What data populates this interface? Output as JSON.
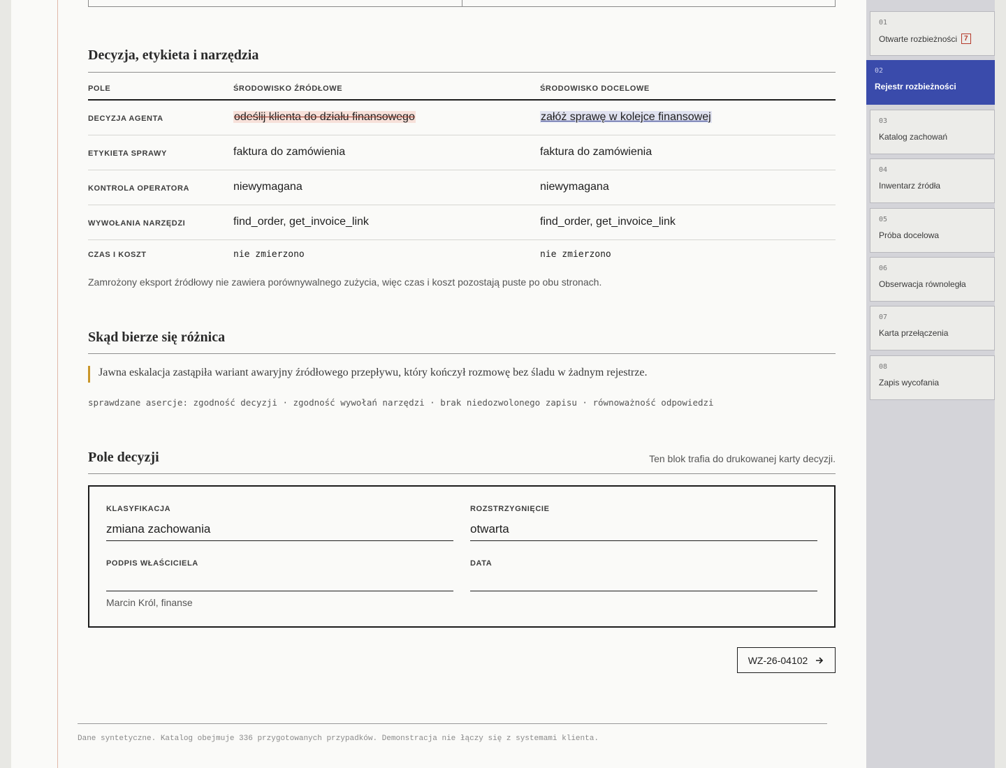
{
  "table_section": {
    "title": "Decyzja, etykieta i narzędzia",
    "columns": [
      "POLE",
      "ŚRODOWISKO ŹRÓDŁOWE",
      "ŚRODOWISKO DOCELOWE"
    ],
    "rows": [
      {
        "label": "DECYZJA AGENTA",
        "source": "odeślij klienta do działu finansowego",
        "target": "załóż sprawę w kolejce finansowej"
      },
      {
        "label": "ETYKIETA SPRAWY",
        "source": "faktura do zamówienia",
        "target": "faktura do zamówienia"
      },
      {
        "label": "KONTROLA OPERATORA",
        "source": "niewymagana",
        "target": "niewymagana"
      },
      {
        "label": "WYWOŁANIA NARZĘDZI",
        "source": "find_order, get_invoice_link",
        "target": "find_order, get_invoice_link"
      },
      {
        "label": "CZAS I KOSZT",
        "source": "nie zmierzono",
        "target": "nie zmierzono"
      }
    ],
    "note": "Zamrożony eksport źródłowy nie zawiera porównywalnego zużycia, więc czas i koszt pozostają puste po obu stronach."
  },
  "difference_section": {
    "title": "Skąd bierze się różnica",
    "quote": "Jawna eskalacja zastąpiła wariant awaryjny źródłowego przepływu, który kończył rozmowę bez śladu w żadnym rejestrze.",
    "assertions": "sprawdzane asercje: zgodność decyzji · zgodność wywołań narzędzi · brak niedozwolonego zapisu · równoważność odpowiedzi"
  },
  "decision_section": {
    "title": "Pole decyzji",
    "print_note": "Ten blok trafia do drukowanej karty decyzji.",
    "classification_label": "KLASYFIKACJA",
    "classification_value": "zmiana zachowania",
    "resolution_label": "ROZSTRZYGNIĘCIE",
    "resolution_value": "otwarta",
    "signature_label": "PODPIS WŁAŚCICIELA",
    "signature_value": "",
    "date_label": "DATA",
    "date_value": "",
    "owner": "Marcin Król, finanse"
  },
  "next_button": {
    "label": "WZ-26-04102",
    "icon": "arrow-right-icon"
  },
  "footer": "Dane syntetyczne. Katalog obejmuje 336 przygotowanych przypadków. Demonstracja nie łączy się z systemami klienta.",
  "sidebar": {
    "items": [
      {
        "num": "01",
        "label": "Otwarte rozbieżności",
        "badge": "7"
      },
      {
        "num": "02",
        "label": "Rejestr rozbieżności",
        "active": true
      },
      {
        "num": "03",
        "label": "Katalog zachowań"
      },
      {
        "num": "04",
        "label": "Inwentarz źródła"
      },
      {
        "num": "05",
        "label": "Próba docelowa"
      },
      {
        "num": "06",
        "label": "Obserwacja równoległa"
      },
      {
        "num": "07",
        "label": "Karta przełączenia"
      },
      {
        "num": "08",
        "label": "Zapis wycofania"
      }
    ]
  },
  "colors": {
    "accent": "#3a4bab",
    "removed_bg": "#f7e0d9",
    "added_bg": "#e0e2f0",
    "quote_bar": "#c9962a",
    "badge": "#b53a2a"
  }
}
